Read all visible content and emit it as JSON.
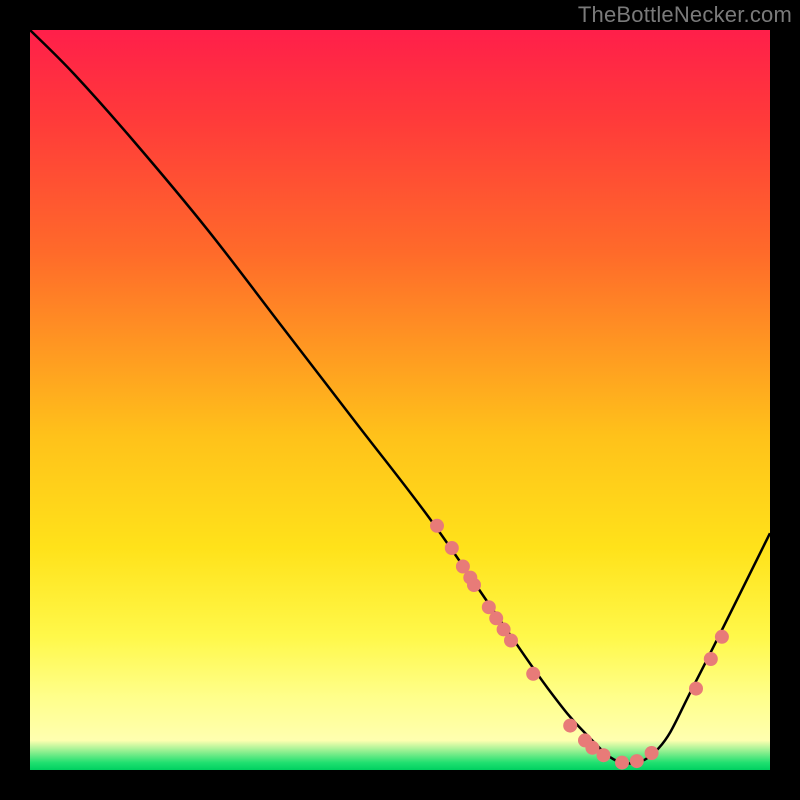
{
  "watermark": "TheBottleNecker.com",
  "chart_data": {
    "type": "line",
    "title": "",
    "xlabel": "",
    "ylabel": "",
    "xlim": [
      0,
      100
    ],
    "ylim": [
      0,
      100
    ],
    "series": [
      {
        "name": "bottleneck-curve",
        "x": [
          0,
          6,
          14,
          24,
          34,
          44,
          54,
          63,
          70,
          75,
          80,
          85,
          90,
          100
        ],
        "values": [
          100,
          94,
          85,
          73,
          60,
          47,
          34,
          21,
          11,
          5,
          1,
          3,
          12,
          32
        ]
      }
    ],
    "markers": [
      {
        "x": 55.0,
        "y": 33.0
      },
      {
        "x": 57.0,
        "y": 30.0
      },
      {
        "x": 58.5,
        "y": 27.5
      },
      {
        "x": 59.5,
        "y": 26.0
      },
      {
        "x": 60.0,
        "y": 25.0
      },
      {
        "x": 62.0,
        "y": 22.0
      },
      {
        "x": 63.0,
        "y": 20.5
      },
      {
        "x": 64.0,
        "y": 19.0
      },
      {
        "x": 65.0,
        "y": 17.5
      },
      {
        "x": 68.0,
        "y": 13.0
      },
      {
        "x": 73.0,
        "y": 6.0
      },
      {
        "x": 75.0,
        "y": 4.0
      },
      {
        "x": 76.0,
        "y": 3.0
      },
      {
        "x": 77.5,
        "y": 2.0
      },
      {
        "x": 80.0,
        "y": 1.0
      },
      {
        "x": 82.0,
        "y": 1.2
      },
      {
        "x": 84.0,
        "y": 2.3
      },
      {
        "x": 90.0,
        "y": 11.0
      },
      {
        "x": 92.0,
        "y": 15.0
      },
      {
        "x": 93.5,
        "y": 18.0
      }
    ],
    "marker_color": "#e87b78",
    "marker_radius_px": 7,
    "gradient_stops": [
      {
        "pos": 0.0,
        "color": "#ff1f4a"
      },
      {
        "pos": 0.12,
        "color": "#ff3a3a"
      },
      {
        "pos": 0.3,
        "color": "#ff6a2a"
      },
      {
        "pos": 0.55,
        "color": "#ffc21a"
      },
      {
        "pos": 0.7,
        "color": "#ffe21a"
      },
      {
        "pos": 0.82,
        "color": "#fff84a"
      },
      {
        "pos": 0.9,
        "color": "#ffff8a"
      },
      {
        "pos": 0.96,
        "color": "#ffffb0"
      },
      {
        "pos": 0.99,
        "color": "#20e070"
      },
      {
        "pos": 1.0,
        "color": "#00d060"
      }
    ]
  }
}
